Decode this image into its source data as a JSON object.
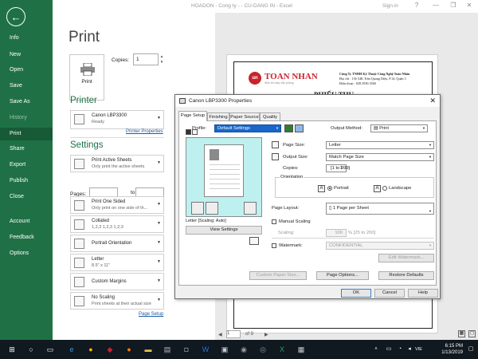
{
  "sidebar": {
    "back_glyph": "←",
    "items": [
      {
        "label": "Info"
      },
      {
        "label": "New"
      },
      {
        "label": "Open"
      },
      {
        "label": "Save"
      },
      {
        "label": "Save As"
      },
      {
        "label": "History"
      },
      {
        "label": "Print"
      },
      {
        "label": "Share"
      },
      {
        "label": "Export"
      },
      {
        "label": "Publish"
      },
      {
        "label": "Close"
      },
      {
        "label": "Account"
      },
      {
        "label": "Feedback"
      },
      {
        "label": "Options"
      }
    ],
    "active": "Print",
    "accent": "#1f7145"
  },
  "titlebar": {
    "title": "HOADON - Cong ty - - CU-DANG IN - Excel",
    "sign_in": "Sign in",
    "help": "?",
    "minimize": "—",
    "restore": "❐",
    "close": "✕"
  },
  "print_panel": {
    "heading": "Print",
    "print_button": "Print",
    "copies_label": "Copies:",
    "copies_value": "1",
    "printer_section": "Printer",
    "printer_name": "Canon LBP3300",
    "printer_status": "Ready",
    "printer_properties": "Printer Properties",
    "settings_section": "Settings",
    "settings": [
      {
        "title": "Print Active Sheets",
        "subtitle": "Only print the active sheets"
      },
      {
        "title": "Print One Sided",
        "subtitle": "Only print on one side of th..."
      },
      {
        "title": "Collated",
        "subtitle": "1,2,3    1,2,3    1,2,3"
      },
      {
        "title": "Portrait Orientation",
        "subtitle": ""
      },
      {
        "title": "Letter",
        "subtitle": "8.5\" x 11\""
      },
      {
        "title": "Custom Margins",
        "subtitle": ""
      },
      {
        "title": "No Scaling",
        "subtitle": "Print sheets at their actual size"
      }
    ],
    "pages_label": "Pages:",
    "pages_to": "to",
    "page_setup": "Page Setup"
  },
  "preview": {
    "logo_mark": "un",
    "logo_text": "TOAN NHAN",
    "logo_tagline": "Siêu thị máy văn phòng",
    "company_lines": [
      "Công Ty TNHH Kỹ Thuật Công Nghệ Toàn Nhân",
      "Địa chỉ : 136 54K Trần Quang Diệu, P.14, Quận 3",
      "Điện thoại : 028.3930.3560"
    ],
    "receipt_title": "PHIẾU THU",
    "receipt_date": "Ngày 27 tháng 10 năm 2018",
    "page_current": "1",
    "page_of": "of 9",
    "prev": "◀",
    "next": "▶"
  },
  "dialog": {
    "title": "Canon LBP3300 Properties",
    "close": "✕",
    "tabs": [
      "Page Setup",
      "Finishing",
      "Paper Source",
      "Quality"
    ],
    "selected_tab": "Page Setup",
    "profile_label": "Profile:",
    "profile_value": "Default Settings",
    "output_method_label": "Output Method:",
    "output_method_value": "Print",
    "page_size_label": "Page Size:",
    "page_size_value": "Letter",
    "output_size_label": "Output Size:",
    "output_size_value": "Match Page Size",
    "copies_label": "Copies:",
    "copies_value": "1",
    "copies_range": "[1 to 999]",
    "orientation_label": "Orientation",
    "portrait": "Portrait",
    "landscape": "Landscape",
    "orientation_selected": "Portrait",
    "page_layout_label": "Page Layout:",
    "page_layout_value": "1 Page per Sheet",
    "manual_scaling": "Manual Scaling",
    "scaling_label": "Scaling:",
    "scaling_value": "100",
    "scaling_range": "% [25 to 200]",
    "watermark_label": "Watermark:",
    "watermark_value": "CONFIDENTIAL",
    "edit_watermark": "Edit Watermark...",
    "preview_caption": "Letter [Scaling: Auto]",
    "view_settings": "View Settings",
    "custom_paper_size": "Custom Paper Size...",
    "page_options": "Page Options...",
    "restore_defaults": "Restore Defaults",
    "ok": "OK",
    "cancel": "Cancel",
    "help": "Help"
  },
  "taskbar": {
    "start": "⊞",
    "time": "6:15 PM",
    "date": "1/13/2019",
    "lang": "VIE"
  }
}
